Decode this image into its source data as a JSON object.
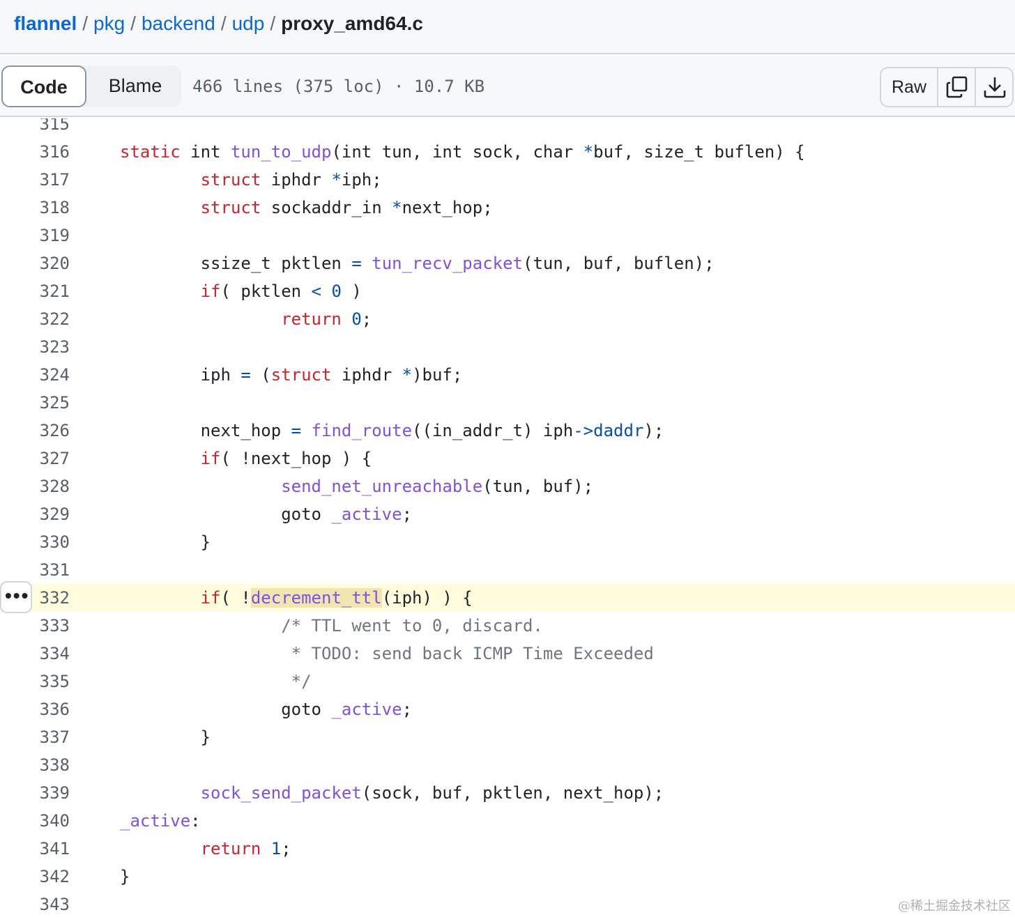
{
  "breadcrumb": {
    "items": [
      "flannel",
      "pkg",
      "backend",
      "udp"
    ],
    "separator": "/",
    "current": "proxy_amd64.c"
  },
  "file_header": {
    "tabs": [
      "Code",
      "Blame"
    ],
    "active_tab": "Code",
    "meta": "466 lines (375 loc) · 10.7 KB",
    "raw_label": "Raw",
    "copy_icon": "copy-icon",
    "download_icon": "download-icon"
  },
  "code": {
    "highlighted_line": "332",
    "line_numbers": [
      "315",
      "316",
      "317",
      "318",
      "319",
      "320",
      "321",
      "322",
      "323",
      "324",
      "325",
      "326",
      "327",
      "328",
      "329",
      "330",
      "331",
      "332",
      "333",
      "334",
      "335",
      "336",
      "337",
      "338",
      "339",
      "340",
      "341",
      "342",
      "343"
    ]
  },
  "line_menu_icon": "kebab-horizontal-icon",
  "watermark": "@稀土掘金技术社区",
  "colors": {
    "link": "#0969da",
    "keyword": "#cf222e",
    "function": "#8250df",
    "constant": "#0550ae",
    "comment": "#6e7781",
    "highlight_line": "#fffbdd"
  }
}
